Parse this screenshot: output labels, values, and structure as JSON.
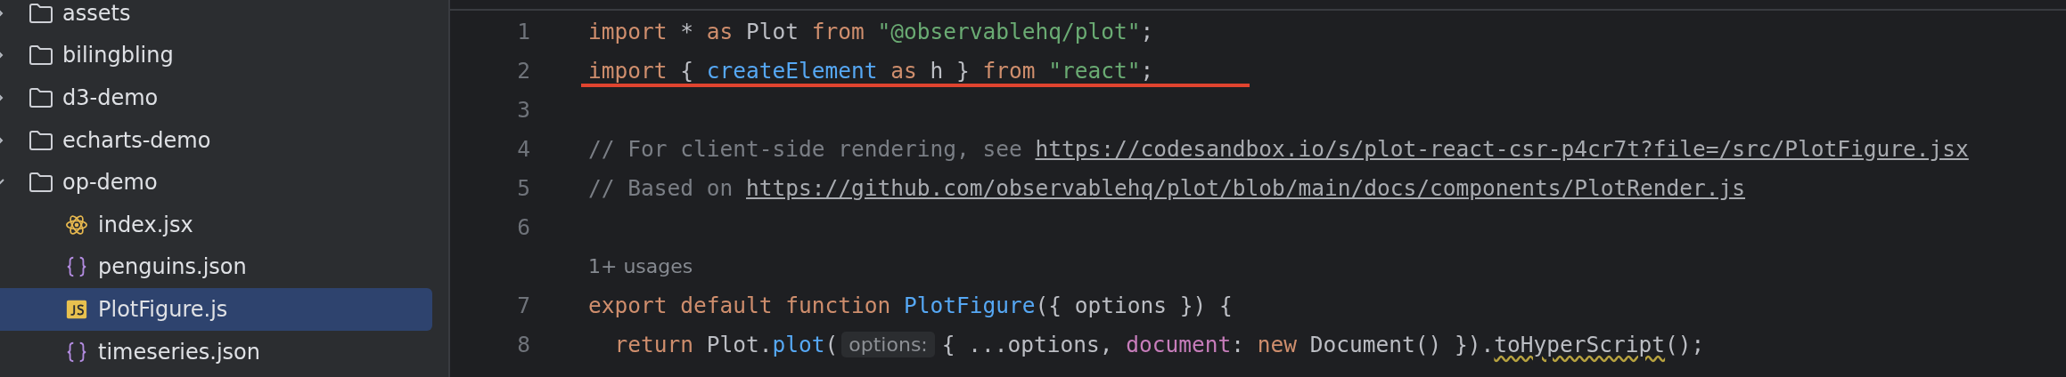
{
  "project_tree": [
    {
      "name": "assets",
      "kind": "folder",
      "expanded": false,
      "selected": false
    },
    {
      "name": "bilingbling",
      "kind": "folder",
      "expanded": false,
      "selected": false
    },
    {
      "name": "d3-demo",
      "kind": "folder",
      "expanded": false,
      "selected": false
    },
    {
      "name": "echarts-demo",
      "kind": "folder",
      "expanded": false,
      "selected": false
    },
    {
      "name": "op-demo",
      "kind": "folder",
      "expanded": true,
      "selected": false,
      "children": [
        {
          "name": "index.jsx",
          "kind": "react",
          "selected": false
        },
        {
          "name": "penguins.json",
          "kind": "json",
          "selected": false
        },
        {
          "name": "PlotFigure.js",
          "kind": "js",
          "selected": true
        },
        {
          "name": "timeseries.json",
          "kind": "json",
          "selected": false
        }
      ]
    }
  ],
  "editor": {
    "lines": [
      {
        "number": "1",
        "segments": [
          {
            "kind": "code",
            "tokens": [
              {
                "t": "import",
                "kind": "keyword"
              },
              {
                "t": " * ",
                "kind": "plain"
              },
              {
                "t": "as",
                "kind": "keyword"
              },
              {
                "t": " Plot ",
                "kind": "plain"
              },
              {
                "t": "from",
                "kind": "keyword"
              },
              {
                "t": " \"@observablehq/plot\"",
                "kind": "string"
              },
              {
                "t": ";",
                "kind": "plain"
              }
            ]
          }
        ]
      },
      {
        "number": "2",
        "underlined": true,
        "segments": [
          {
            "kind": "code",
            "tokens": [
              {
                "t": "import",
                "kind": "keyword"
              },
              {
                "t": " { ",
                "kind": "plain"
              },
              {
                "t": "createElement",
                "kind": "function"
              },
              {
                "t": " as",
                "kind": "keyword"
              },
              {
                "t": " h } ",
                "kind": "plain"
              },
              {
                "t": "from",
                "kind": "keyword"
              },
              {
                "t": " \"react\"",
                "kind": "string"
              },
              {
                "t": ";",
                "kind": "plain"
              }
            ]
          }
        ]
      },
      {
        "number": "3"
      },
      {
        "number": "4",
        "segments": [
          {
            "kind": "code",
            "tokens": [
              {
                "t": "// For client-side rendering, see ",
                "kind": "comment"
              }
            ]
          },
          {
            "kind": "link",
            "text": "https://codesandbox.io/s/plot-react-csr-p4cr7t?file=/src/PlotFigure.jsx"
          }
        ]
      },
      {
        "number": "5",
        "segments": [
          {
            "kind": "code",
            "tokens": [
              {
                "t": "// Based on ",
                "kind": "comment"
              }
            ]
          },
          {
            "kind": "link",
            "text": "https://github.com/observablehq/plot/blob/main/docs/components/PlotRender.js"
          }
        ]
      },
      {
        "number": "6"
      },
      {
        "usages": "1+ usages"
      },
      {
        "number": "7",
        "segments": [
          {
            "kind": "code",
            "tokens": [
              {
                "t": "export default function",
                "kind": "keyword"
              },
              {
                "t": " PlotFigure",
                "kind": "function"
              },
              {
                "t": "({ options }) {",
                "kind": "plain"
              }
            ]
          }
        ]
      },
      {
        "number": "8",
        "segments": [
          {
            "kind": "code",
            "tokens": [
              {
                "t": "  return",
                "kind": "keyword"
              },
              {
                "t": " Plot.",
                "kind": "plain"
              },
              {
                "t": "plot",
                "kind": "function"
              },
              {
                "t": "(",
                "kind": "plain"
              }
            ]
          },
          {
            "kind": "hint",
            "text": "options:"
          },
          {
            "kind": "code",
            "tokens": [
              {
                "t": "{ ...options, ",
                "kind": "plain"
              },
              {
                "t": "document",
                "kind": "property"
              },
              {
                "t": ": ",
                "kind": "plain"
              },
              {
                "t": "new",
                "kind": "keyword"
              },
              {
                "t": " Document() }).",
                "kind": "plain"
              },
              {
                "t": "toHyperScript",
                "kind": "warning"
              },
              {
                "t": "();",
                "kind": "plain"
              }
            ]
          }
        ]
      }
    ]
  }
}
